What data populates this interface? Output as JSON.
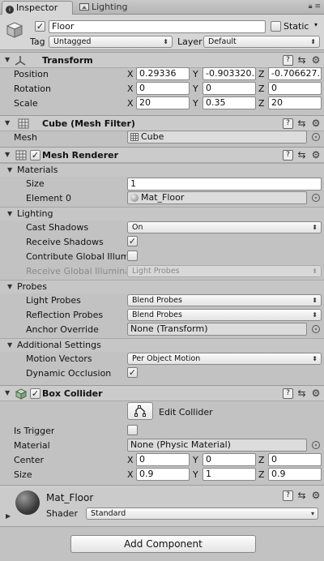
{
  "tabs": [
    {
      "label": "Inspector",
      "icon": "info-icon",
      "active": true
    },
    {
      "label": "Lighting",
      "icon": "lighting-icon",
      "active": false
    }
  ],
  "tab_menu": {
    "lock_icon": "lock-icon",
    "menu_icon": "tab-menu-icon"
  },
  "header": {
    "name": "Floor",
    "active_checked": true,
    "static_label": "Static",
    "static_checked": false,
    "tag_label": "Tag",
    "tag_value": "Untagged",
    "layer_label": "Layer",
    "layer_value": "Default"
  },
  "transform": {
    "title": "Transform",
    "rows": [
      {
        "label": "Position",
        "x": "0.29336",
        "y": "-0.903320…",
        "z": "-0.706627…"
      },
      {
        "label": "Rotation",
        "x": "0",
        "y": "0",
        "z": "0"
      },
      {
        "label": "Scale",
        "x": "20",
        "y": "0.35",
        "z": "20"
      }
    ],
    "axis_labels": {
      "x": "X",
      "y": "Y",
      "z": "Z"
    }
  },
  "mesh_filter": {
    "title": "Cube (Mesh Filter)",
    "mesh_label": "Mesh",
    "mesh_value": "Cube"
  },
  "mesh_renderer": {
    "title": "Mesh Renderer",
    "enabled": true,
    "materials_header": "Materials",
    "size_label": "Size",
    "size_value": "1",
    "element0_label": "Element 0",
    "element0_value": "Mat_Floor",
    "lighting_header": "Lighting",
    "cast_shadows_label": "Cast Shadows",
    "cast_shadows_value": "On",
    "receive_shadows_label": "Receive Shadows",
    "receive_shadows_checked": true,
    "contribute_gi_label": "Contribute Global Illum",
    "contribute_gi_checked": false,
    "receive_gi_label": "Receive Global Illuminat",
    "receive_gi_value": "Light Probes",
    "probes_header": "Probes",
    "light_probes_label": "Light Probes",
    "light_probes_value": "Blend Probes",
    "reflection_probes_label": "Reflection Probes",
    "reflection_probes_value": "Blend Probes",
    "anchor_override_label": "Anchor Override",
    "anchor_override_value": "None (Transform)",
    "additional_header": "Additional Settings",
    "motion_vectors_label": "Motion Vectors",
    "motion_vectors_value": "Per Object Motion",
    "dynamic_occlusion_label": "Dynamic Occlusion",
    "dynamic_occlusion_checked": true
  },
  "box_collider": {
    "title": "Box Collider",
    "enabled": true,
    "edit_collider_label": "Edit Collider",
    "is_trigger_label": "Is Trigger",
    "is_trigger_checked": false,
    "material_label": "Material",
    "material_value": "None (Physic Material)",
    "center_label": "Center",
    "center": {
      "x": "0",
      "y": "0",
      "z": "0"
    },
    "size_label": "Size",
    "size": {
      "x": "0.9",
      "y": "1",
      "z": "0.9"
    }
  },
  "material": {
    "name": "Mat_Floor",
    "shader_label": "Shader",
    "shader_value": "Standard"
  },
  "add_component_label": "Add Component",
  "check_glyph": "✓",
  "colors": {
    "background": "#c2c2c2",
    "header": "#cbcbcb",
    "field": "#ffffff"
  }
}
